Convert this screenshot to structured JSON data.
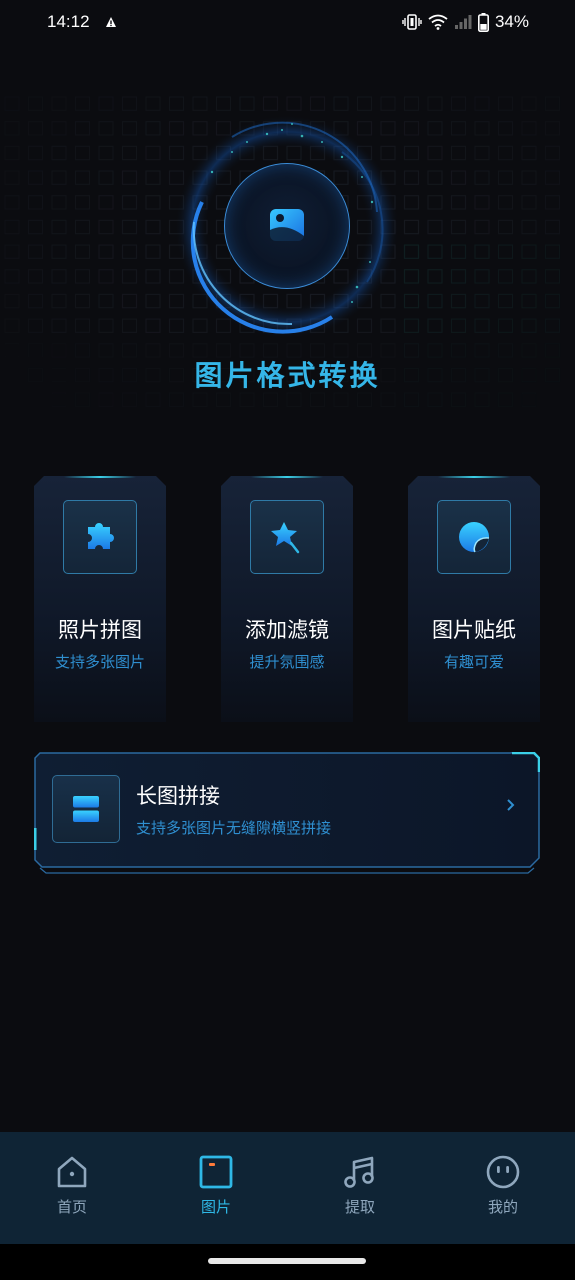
{
  "status_bar": {
    "time": "14:12",
    "battery": "34%"
  },
  "hero": {
    "title": "图片格式转换",
    "icon": "image-icon"
  },
  "cards": [
    {
      "title": "照片拼图",
      "subtitle": "支持多张图片",
      "icon": "puzzle-icon"
    },
    {
      "title": "添加滤镜",
      "subtitle": "提升氛围感",
      "icon": "magic-wand-icon"
    },
    {
      "title": "图片贴纸",
      "subtitle": "有趣可爱",
      "icon": "sticker-icon"
    }
  ],
  "banner": {
    "title": "长图拼接",
    "subtitle": "支持多张图片无缝隙横竖拼接",
    "icon": "stack-icon"
  },
  "bottom_nav": {
    "items": [
      {
        "label": "首页",
        "icon": "home-icon",
        "active": false
      },
      {
        "label": "图片",
        "icon": "picture-icon",
        "active": true
      },
      {
        "label": "提取",
        "icon": "music-note-icon",
        "active": false
      },
      {
        "label": "我的",
        "icon": "face-icon",
        "active": false
      }
    ]
  },
  "colors": {
    "accent": "#2fb8e6",
    "background": "#0b0c10",
    "subtitle": "#2f8fd0",
    "nav_background": "#0f2435"
  }
}
